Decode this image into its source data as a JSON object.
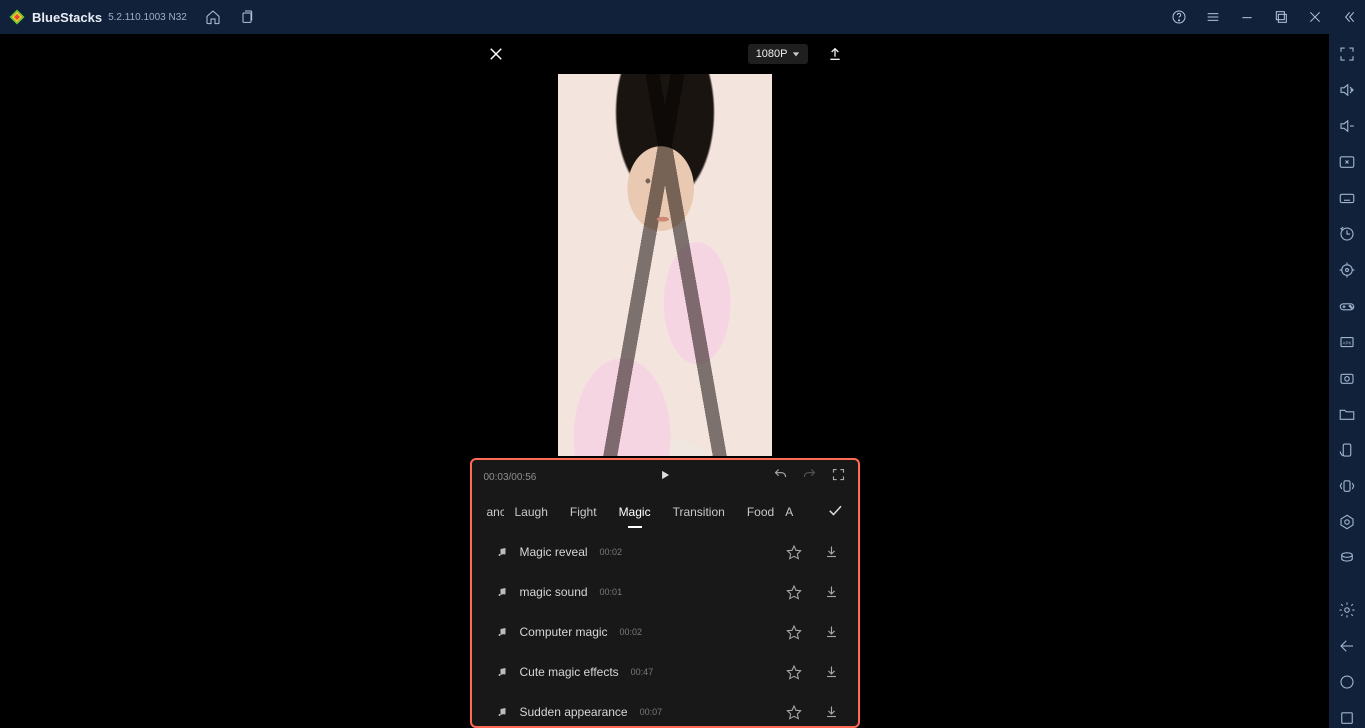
{
  "titlebar": {
    "brand": "BlueStacks",
    "version": "5.2.110.1003  N32"
  },
  "phone": {
    "resolution_label": "1080P",
    "time_display": "00:03/00:56"
  },
  "tabs": {
    "partial_left": "ance",
    "items": [
      "Laugh",
      "Fight",
      "Magic",
      "Transition",
      "Food"
    ],
    "partial_right": "A",
    "active": "Magic"
  },
  "sounds": [
    {
      "name": "Magic reveal",
      "duration": "00:02"
    },
    {
      "name": "magic sound",
      "duration": "00:01"
    },
    {
      "name": "Computer magic",
      "duration": "00:02"
    },
    {
      "name": "Cute magic effects",
      "duration": "00:47"
    },
    {
      "name": "Sudden appearance",
      "duration": "00:07"
    }
  ]
}
